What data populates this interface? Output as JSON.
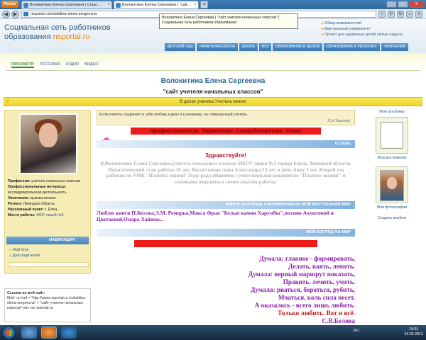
{
  "browser": {
    "app_button": "Firefox",
    "tabs": [
      {
        "label": "Волокитина Елена Сергеевна | Соци..."
      },
      {
        "label": "Волокитина Елена Сергеевна | \"сай..."
      }
    ],
    "url": "nsportal.ru/volokitina-elena-sergeevna",
    "tooltip": "Волокитина Елена Сергеевна | \"сайт учителя начальных классов\" | Социальная сеть работников образования"
  },
  "site": {
    "logo_line1": "Социальная сеть работников",
    "logo_line2": "образования",
    "logo_brand": "nsportal.ru",
    "top_links": [
      "Обзор возможностей",
      "Виртуальный университет",
      "Проект для одаренных детей «Алые паруса»"
    ],
    "categories": [
      "ДЕТСКИЙ САД",
      "НАЧАЛЬНАЯ ШКОЛА",
      "ШКОЛА",
      "ВУЗ",
      "ОБРАЗОВАНИЕ В ЦЕЛОМ",
      "ОБРАЗОВАНИЕ В РЕГИОНАХ",
      "УВЛЕЧЕНИЯ"
    ],
    "subtabs": [
      "ПРОСМОТР",
      "ГОСТЕВАЯ",
      "АУДИО",
      "ВИДЕО"
    ]
  },
  "profile": {
    "name": "Волокитина Елена Сергеевна",
    "site_title": "\"сайт учителя начальных классов\"",
    "banner": "В делах ученика Учитель вечен!",
    "profession_label": "Профессия:",
    "profession": "учитель начальных классов",
    "interests_label": "Профессиональные интересы:",
    "interests": "исследовательская деятельность",
    "hobbies_label": "Увлечения:",
    "hobbies": "музыка,поэзия",
    "region_label": "Регион:",
    "region": "Липецкая область",
    "city_label": "Населенный пункт:",
    "city": "г. Елец",
    "work_label": "Место работы:",
    "work": "МОУ лицей №5"
  },
  "navigation": {
    "header": "НАВИГАЦИЯ",
    "links": [
      "Мой блог",
      "Для родителей"
    ]
  },
  "linkbox": {
    "title": "Ссылка на мой сайт:",
    "text": "Мой <a href = \"http://www.nsportal.ru /volokitina-elena-sergeevna\" > \"сайт учителя начальных классов\"</a> на nsportal.ru"
  },
  "main": {
    "quote": "Если учитель соединяет в себе любовь к делу и к ученикам, он совершенный учитель.",
    "quote_author": "Л.Н.Толстой",
    "motto": "Профессионализм. Творчество. Сотрудничество. Успех.",
    "about_header": "О СЕБЕ",
    "hello": "Здравствуйте!",
    "about_text": "Я,Волокитина Елена Сергеевна,учитель начальных классов МБОУ лицея №5 города Ельца Липецкой области. Педагогический стаж работы-16 лет. Воспитываю сына Александра 13 лет и дочь Анну 3 лет. Второй год работаю по УМК \"Планета знаний\".Буду рада общению с учителями,шагающими по \"Планете знаний\" и готовыми поделиться своим опытом работы.",
    "inner_header": "КНИГИ, КОТОРЫЕ СФОРМИРОВАЛИ МОЙ ВНУТРЕННИЙ МИР",
    "books_text": "Люблю книги П.Коэльо,Э.М. Ремарка,Макса Фрая \"Белые камни Харумбы\",поэзию Ахматовой и Цветаевой,Омара Хайяма...",
    "view_header": "МОЙ ВЗГЛЯД НА МИР",
    "poem": [
      "Думала: главное - формировать,",
      "Делать, ваять, лепить.",
      "Думала: верный маршрут показать,",
      "Править, лечить, учить.",
      "Думала: рваться, бороться, рубить,",
      "Мчаться, коль сила несет.",
      "А оказалось - всего лишь любить."
    ],
    "poem_last": "Только любить. Вот и всё.",
    "poem_author": "С.В.Белова"
  },
  "albums": {
    "header": "Мои альбомы",
    "items": [
      "Мои достижения",
      "Мои фотографии"
    ],
    "create": "Создать альбом"
  },
  "taskbar": {
    "lang": "RU",
    "time": "19:01",
    "date": "24.02.2012"
  }
}
